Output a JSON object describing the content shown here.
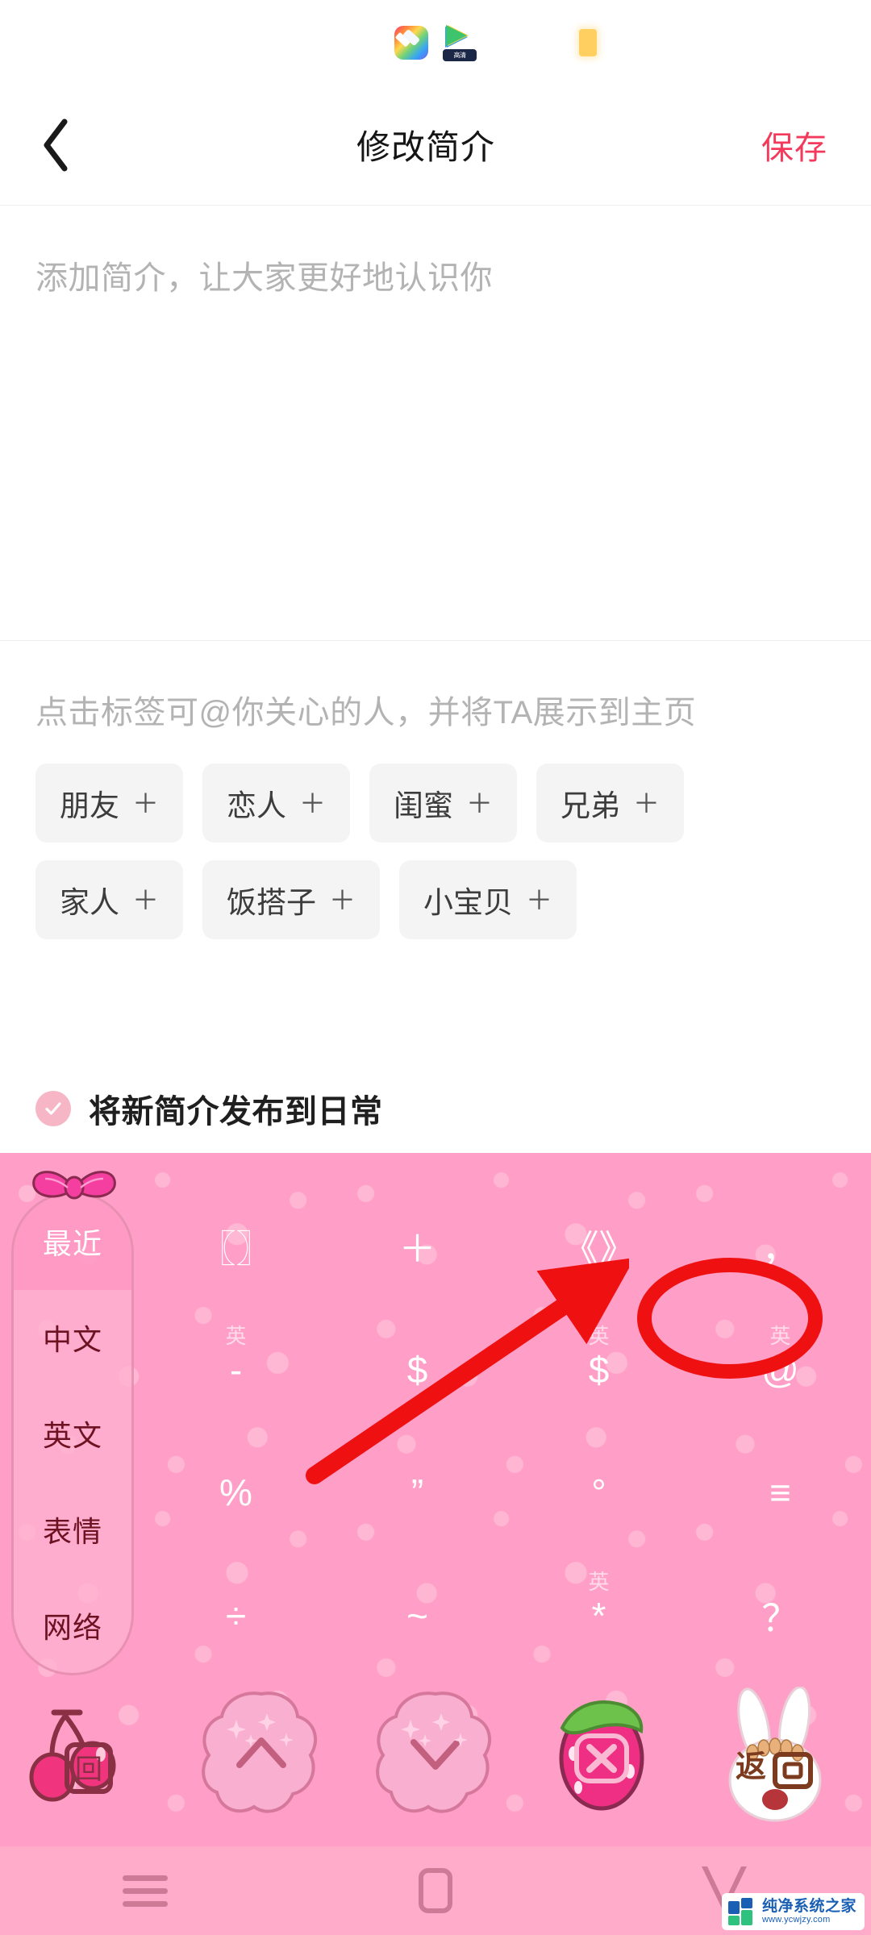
{
  "statusbar": {
    "notification_icons": [
      "gallery-app-icon",
      "video-app-icon"
    ],
    "video_icon_tag": "高清",
    "battery_color": "#ffd060"
  },
  "header": {
    "back_icon": "chevron-left-icon",
    "title": "修改简介",
    "save_label": "保存",
    "save_color": "#f43a5c"
  },
  "bio": {
    "placeholder": "添加简介，让大家更好地认识你",
    "value": ""
  },
  "tags": {
    "hint": "点击标签可@你关心的人，并将TA展示到主页",
    "plus": "＋",
    "rows": [
      [
        "朋友",
        "恋人",
        "闺蜜",
        "兄弟"
      ],
      [
        "家人",
        "饭搭子",
        "小宝贝"
      ]
    ]
  },
  "publish": {
    "checked": true,
    "label": "将新简介发布到日常",
    "check_color": "#f6b6c5"
  },
  "keyboard": {
    "sidebar_tabs": [
      {
        "label": "最近",
        "active": true
      },
      {
        "label": "中文",
        "active": false
      },
      {
        "label": "英文",
        "active": false
      },
      {
        "label": "表情",
        "active": false
      },
      {
        "label": "网络",
        "active": false
      }
    ],
    "bow_icon": "pink-bow-icon",
    "keys": [
      {
        "glyph": "〖〗",
        "badge": ""
      },
      {
        "glyph": "＋",
        "badge": ""
      },
      {
        "glyph": "《》",
        "badge": ""
      },
      {
        "glyph": "，",
        "badge": ""
      },
      {
        "glyph": "-",
        "badge": "英"
      },
      {
        "glyph": "$",
        "badge": ""
      },
      {
        "glyph": "$",
        "badge": "英"
      },
      {
        "glyph": "@",
        "badge": "英"
      },
      {
        "glyph": "%",
        "badge": ""
      },
      {
        "glyph": "”",
        "badge": ""
      },
      {
        "glyph": "°",
        "badge": ""
      },
      {
        "glyph": "≡",
        "badge": ""
      },
      {
        "glyph": "÷",
        "badge": ""
      },
      {
        "glyph": "~",
        "badge": ""
      },
      {
        "glyph": "*",
        "badge": "英"
      },
      {
        "glyph": "？",
        "badge": ""
      }
    ],
    "function_keys": [
      {
        "name": "cherry-switch-icon",
        "glyph": "回"
      },
      {
        "name": "page-up-icon",
        "glyph": "∧"
      },
      {
        "name": "page-down-icon",
        "glyph": "∨"
      },
      {
        "name": "close-keyboard-icon",
        "glyph": "✕"
      },
      {
        "name": "rabbit-return-icon",
        "glyph": "返回"
      }
    ],
    "background_color": "#ff9ac4"
  },
  "annotation": {
    "circle_target": "@",
    "arrow": "red-arrow-pointing-to-at-key",
    "color": "#ef1111"
  },
  "navbar": {
    "items": [
      {
        "name": "recents-menu-icon"
      },
      {
        "name": "home-square-icon"
      },
      {
        "name": "back-triangle-icon"
      }
    ],
    "background_color": "#ffaccb"
  },
  "watermark": {
    "name": "纯净系统之家",
    "url": "www.ycwjzy.com"
  }
}
